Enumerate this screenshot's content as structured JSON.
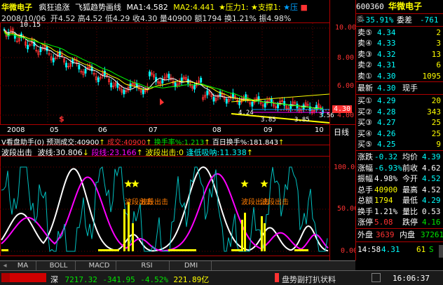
{
  "header": {
    "stock_name": "华微电子",
    "indicator_1": "疯狂追涨",
    "indicator_2": "飞狐趋势画线",
    "ma1": "MA1:4.582",
    "ma2": "MA2:4.441",
    "pressure1": "★压力1:",
    "support1": "★支撑1:",
    "pressure_blue": "★压",
    "extra": "■",
    "date": "2008/10/06",
    "open": "开4.52",
    "high": "高4.52",
    "low": "低4.29",
    "close": "收4.30",
    "volume": "量40900",
    "amount": "额1794",
    "turnover": "换1.21%",
    "amplitude": "振4.98%"
  },
  "price_axis": [
    "10.00",
    "8.00",
    "6.00",
    "4.00"
  ],
  "price_annotations": {
    "high_marker": "10.15",
    "current_price": "4.30",
    "low_a": "4.24",
    "low_b": "3.85",
    "low_c": "3.85",
    "low_d": "3.56"
  },
  "date_axis": [
    "2008",
    "05",
    "06",
    "07",
    "08",
    "09",
    "10"
  ],
  "period_label": "日线",
  "signal_marker": "$",
  "volume_header": {
    "title": "V看盘助手(0)",
    "forecast": "预测成交:40900",
    "vol_label": "成交:40900",
    "turnover_rate": "换手率%:1.213",
    "turnover_100": "百日换手%:181.843"
  },
  "wave_header": {
    "title": "波段出击",
    "wave_line": "波线:30.806",
    "band_line": "段线:23.166",
    "band_attack": "波段出击:0",
    "low_absorb": "逢低吸呐:11.338"
  },
  "wave_axis": [
    "100.00",
    "50.00",
    "0.00"
  ],
  "wave_labels": [
    "波段出击",
    "波段出击",
    "波段出击",
    "波段出击"
  ],
  "tabs": [
    "MA",
    "BOLL",
    "MACD",
    "RSI",
    "DMI"
  ],
  "right_panel": {
    "code": "600360",
    "name": "华微电子",
    "ratio": "-35.91%",
    "diff_label": "委差",
    "diff_value": "-761",
    "sell": [
      {
        "label": "卖⑤",
        "price": "4.34",
        "vol": "2"
      },
      {
        "label": "卖④",
        "price": "4.33",
        "vol": "3"
      },
      {
        "label": "卖③",
        "price": "4.32",
        "vol": "13"
      },
      {
        "label": "卖②",
        "price": "4.31",
        "vol": "6"
      },
      {
        "label": "卖①",
        "price": "4.30",
        "vol": "1095"
      }
    ],
    "latest_label": "最新",
    "latest_price": "4.30",
    "current_label": "现手",
    "current_value": "",
    "buy": [
      {
        "label": "买①",
        "price": "4.29",
        "vol": "20"
      },
      {
        "label": "买②",
        "price": "4.28",
        "vol": "343"
      },
      {
        "label": "买③",
        "price": "4.27",
        "vol": "25"
      },
      {
        "label": "买④",
        "price": "4.26",
        "vol": "25"
      },
      {
        "label": "买⑤",
        "price": "4.25",
        "vol": "9"
      }
    ],
    "stats": [
      {
        "l1": "涨跌",
        "v1": "-0.32",
        "l2": "均价",
        "v2": "4.39"
      },
      {
        "l1": "涨幅",
        "v1": "-6.93%",
        "l2": "前收",
        "v2": "4.62"
      },
      {
        "l1": "振幅",
        "v1": "4.98%",
        "l2": "今开",
        "v2": "4.52"
      },
      {
        "l1": "总手",
        "v1": "40900",
        "l2": "最高",
        "v2": "4.52"
      },
      {
        "l1": "总额",
        "v1": "1794",
        "l2": "最低",
        "v2": "4.29"
      },
      {
        "l1": "换手",
        "v1": "1.21%",
        "l2": "量比",
        "v2": "0.53"
      },
      {
        "l1": "涨停",
        "v1": "5.08",
        "l2": "跌停",
        "v2": "4.16"
      }
    ],
    "outer_label": "外盘",
    "outer_value": "3639",
    "inner_label": "内盘",
    "inner_value": "37261",
    "time": "14:58",
    "time_value": "4.31",
    "time_vol": "61",
    "time_side": "S"
  },
  "status": {
    "market": "深",
    "index": "7217.32",
    "change": "-341.95",
    "pct": "-4.52%",
    "amount": "221.89亿",
    "news": "盘势副打扒状料",
    "clock": "16:06:37"
  },
  "colors": {
    "up": "#ff3232",
    "down": "#00ffff",
    "ma1": "#ffffff",
    "ma2": "#ffff00",
    "frame": "#b00000"
  }
}
